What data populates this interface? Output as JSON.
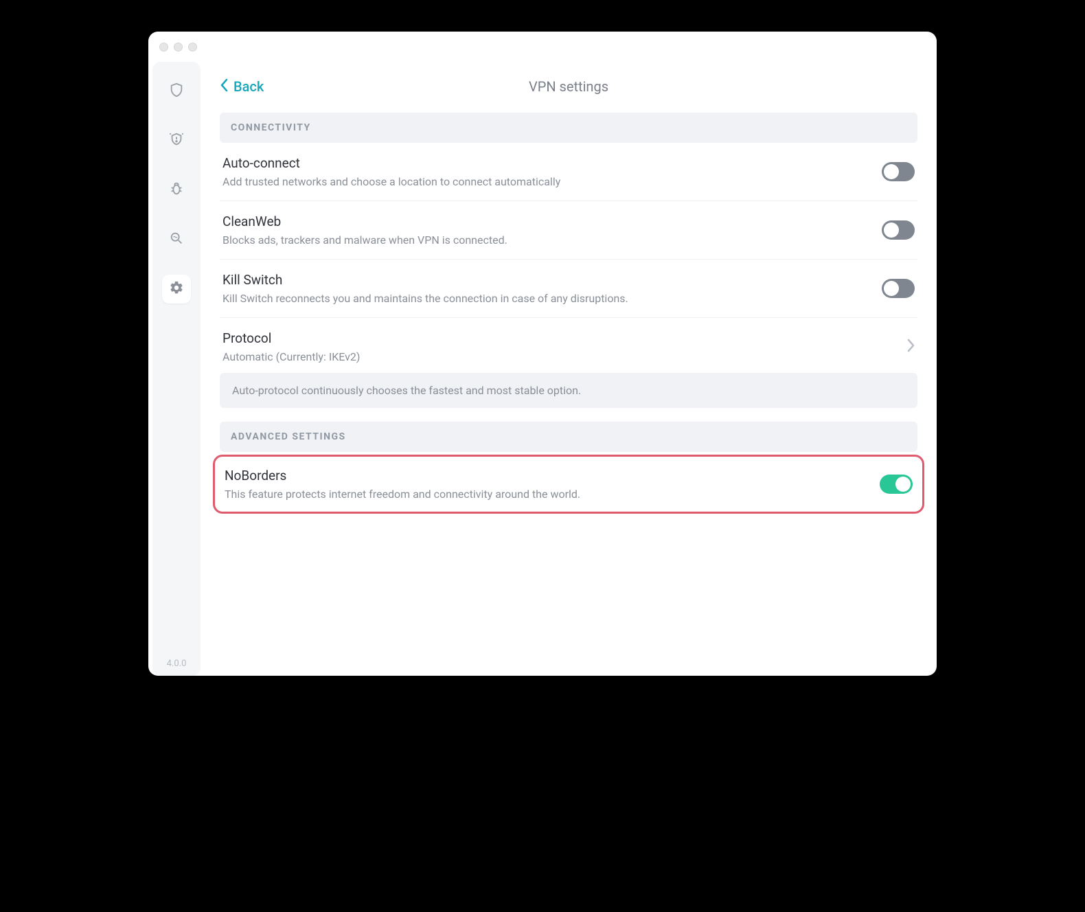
{
  "header": {
    "back_label": "Back",
    "title": "VPN settings"
  },
  "sidebar": {
    "items": [
      {
        "name": "shield-icon"
      },
      {
        "name": "alert-icon"
      },
      {
        "name": "bug-icon"
      },
      {
        "name": "search-icon"
      },
      {
        "name": "gear-icon"
      }
    ],
    "active_index": 4,
    "version": "4.0.0"
  },
  "sections": {
    "connectivity": {
      "header": "CONNECTIVITY",
      "items": [
        {
          "title": "Auto-connect",
          "sub": "Add trusted networks and choose a location to connect automatically",
          "type": "toggle",
          "on": false
        },
        {
          "title": "CleanWeb",
          "sub": "Blocks ads, trackers and malware when VPN is connected.",
          "type": "toggle",
          "on": false
        },
        {
          "title": "Kill Switch",
          "sub": "Kill Switch reconnects you and maintains the connection in case of any disruptions.",
          "type": "toggle",
          "on": false
        },
        {
          "title": "Protocol",
          "sub": "Automatic (Currently: IKEv2)",
          "type": "nav",
          "info": "Auto-protocol continuously chooses the fastest and most stable option."
        }
      ]
    },
    "advanced": {
      "header": "ADVANCED SETTINGS",
      "items": [
        {
          "title": "NoBorders",
          "sub": "This feature protects internet freedom and connectivity around the world.",
          "type": "toggle",
          "on": true,
          "highlighted": true
        }
      ]
    }
  }
}
